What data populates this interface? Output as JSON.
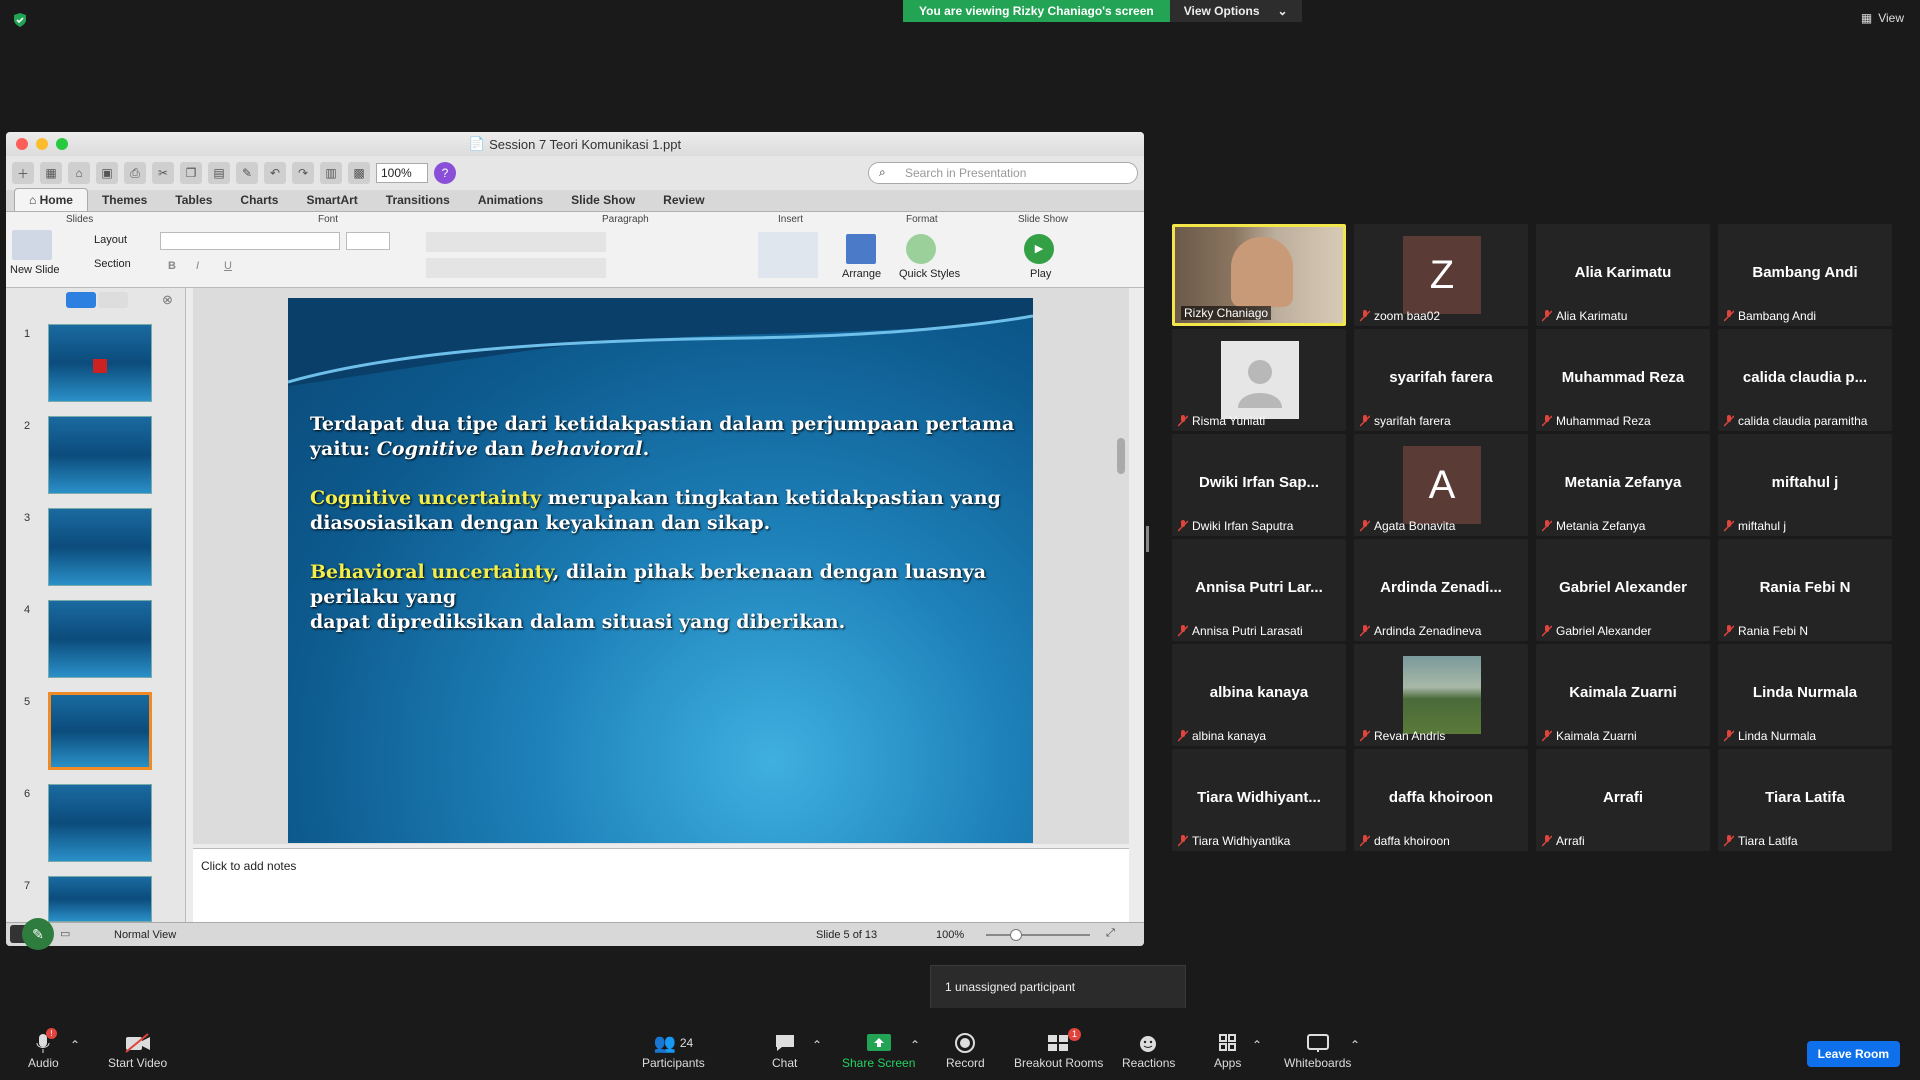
{
  "banner": {
    "viewing": "You are viewing Rizky Chaniago's screen",
    "view_options": "View Options"
  },
  "view_button": "View",
  "ppt": {
    "title": "Session 7 Teori Komunikasi 1.ppt",
    "zoom": "100%",
    "search_placeholder": "Search in Presentation",
    "tabs": [
      "Home",
      "Themes",
      "Tables",
      "Charts",
      "SmartArt",
      "Transitions",
      "Animations",
      "Slide Show",
      "Review"
    ],
    "groups": {
      "slides": "Slides",
      "font": "Font",
      "paragraph": "Paragraph",
      "insert": "Insert",
      "format": "Format",
      "slideshow": "Slide Show"
    },
    "ribbon_labels": {
      "layout": "Layout",
      "section": "Section",
      "new_slide": "New Slide",
      "arrange": "Arrange",
      "quick_styles": "Quick Styles",
      "play": "Play"
    },
    "slide_numbers": [
      "1",
      "2",
      "3",
      "4",
      "5",
      "6",
      "7"
    ],
    "slide": {
      "p1a": "Terdapat dua tipe dari ketidakpastian dalam perjumpaan pertama",
      "p1b_prefix": "yaitu: ",
      "p1b_italic1": "Cognitive",
      "p1b_mid": " dan ",
      "p1b_italic2": "behavioral",
      "p1b_end": ".",
      "p2_hl": "Cognitive uncertainty",
      "p2_rest": " merupakan tingkatan ketidakpastian yang",
      "p2b": "diasosiasikan dengan keyakinan dan sikap.",
      "p3_hl": "Behavioral uncertainty",
      "p3_rest": ", dilain pihak berkenaan dengan luasnya perilaku yang",
      "p3b": "dapat diprediksikan dalam situasi yang diberikan."
    },
    "notes_placeholder": "Click to add notes",
    "status": {
      "view": "Normal View",
      "slide": "Slide 5 of 13",
      "zoom": "100%"
    }
  },
  "participants": [
    {
      "big": "",
      "name": "Rizky Chaniago",
      "kind": "video"
    },
    {
      "big": "Z",
      "name": "zoom baa02",
      "kind": "letter",
      "color": "#5a3b36"
    },
    {
      "big": "Alia Karimatu",
      "name": "Alia Karimatu"
    },
    {
      "big": "Bambang Andi",
      "name": "Bambang Andi"
    },
    {
      "big": "",
      "name": "Risma Yuniati",
      "kind": "person"
    },
    {
      "big": "syarifah farera",
      "name": "syarifah farera"
    },
    {
      "big": "Muhammad Reza",
      "name": "Muhammad Reza"
    },
    {
      "big": "calida claudia p...",
      "name": "calida claudia paramitha"
    },
    {
      "big": "Dwiki Irfan Sap...",
      "name": "Dwiki Irfan Saputra"
    },
    {
      "big": "A",
      "name": "Agata Bonavita",
      "kind": "letter",
      "color": "#5a3b36"
    },
    {
      "big": "Metania Zefanya",
      "name": "Metania Zefanya"
    },
    {
      "big": "miftahul j",
      "name": "miftahul j"
    },
    {
      "big": "Annisa Putri Lar...",
      "name": "Annisa Putri Larasati"
    },
    {
      "big": "Ardinda Zenadi...",
      "name": "Ardinda Zenadineva"
    },
    {
      "big": "Gabriel Alexander",
      "name": "Gabriel Alexander"
    },
    {
      "big": "Rania Febi N",
      "name": "Rania Febi N"
    },
    {
      "big": "albina kanaya",
      "name": "albina kanaya"
    },
    {
      "big": "",
      "name": "Revan Andris",
      "kind": "landscape"
    },
    {
      "big": "Kaimala Zuarni",
      "name": "Kaimala Zuarni"
    },
    {
      "big": "Linda Nurmala",
      "name": "Linda Nurmala"
    },
    {
      "big": "Tiara Widhiyant...",
      "name": "Tiara Widhiyantika"
    },
    {
      "big": "daffa khoiroon",
      "name": "daffa khoiroon"
    },
    {
      "big": "Arrafi",
      "name": "Arrafi"
    },
    {
      "big": "Tiara Latifa",
      "name": "Tiara Latifa"
    }
  ],
  "tooltip": "1 unassigned participant",
  "bottom": {
    "audio": "Audio",
    "audio_badge": "!",
    "start_video": "Start Video",
    "participants": "Participants",
    "participants_count": "24",
    "chat": "Chat",
    "share_screen": "Share Screen",
    "record": "Record",
    "breakout_rooms": "Breakout Rooms",
    "breakout_badge": "1",
    "reactions": "Reactions",
    "apps": "Apps",
    "whiteboards": "Whiteboards",
    "leave_room": "Leave Room"
  },
  "colors": {
    "share_green": "#23a455",
    "leave_blue": "#0e71eb",
    "highlight_yellow": "#f3ee4a",
    "speaker_border": "#f2e64a",
    "mic_muted_red": "#e0443c"
  }
}
